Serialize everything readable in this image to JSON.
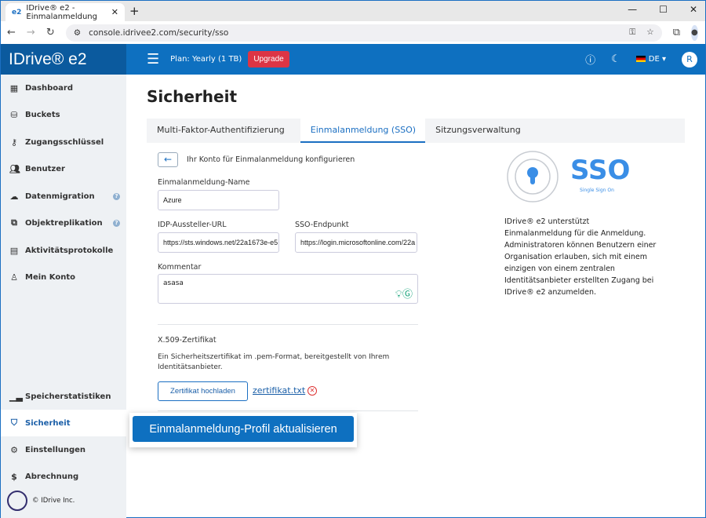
{
  "browser": {
    "tab_title": "IDrive® e2 - Einmalanmeldung",
    "favicon": "e2",
    "url": "console.idrivee2.com/security/sso"
  },
  "header": {
    "logo": "IDrive® e2",
    "plan": "Plan: Yearly (1 TB)",
    "upgrade": "Upgrade",
    "lang": "DE",
    "user_initial": "R"
  },
  "sidebar": {
    "items": [
      {
        "label": "Dashboard",
        "icon": "dashboard-icon"
      },
      {
        "label": "Buckets",
        "icon": "bucket-icon"
      },
      {
        "label": "Zugangsschlüssel",
        "icon": "key-icon"
      },
      {
        "label": "Benutzer",
        "icon": "users-icon"
      },
      {
        "label": "Datenmigration",
        "icon": "cloud-icon"
      },
      {
        "label": "Objektreplikation",
        "icon": "replication-icon"
      },
      {
        "label": "Aktivitätsprotokolle",
        "icon": "log-icon"
      },
      {
        "label": "Mein Konto",
        "icon": "user-icon"
      },
      {
        "label": "Speicherstatistiken",
        "icon": "chart-icon"
      },
      {
        "label": "Sicherheit",
        "icon": "shield-icon"
      },
      {
        "label": "Einstellungen",
        "icon": "gear-icon"
      },
      {
        "label": "Abrechnung",
        "icon": "dollar-icon"
      }
    ],
    "copyright": "© IDrive Inc."
  },
  "page": {
    "title": "Sicherheit",
    "tabs": [
      "Multi-Faktor-Authentifizierung",
      "Einmalanmeldung (SSO)",
      "Sitzungsverwaltung"
    ],
    "back_text": "Ihr Konto für Einmalanmeldung konfigurieren",
    "name_label": "Einmalanmeldung-Name",
    "name_value": "Azure",
    "idp_label": "IDP-Aussteller-URL",
    "idp_value": "https://sts.windows.net/22a1673e-e5",
    "sso_label": "SSO-Endpunkt",
    "sso_value": "https://login.microsoftonline.com/22a",
    "comment_label": "Kommentar",
    "comment_value": "asasa",
    "cert_title": "X.509-Zertifikat",
    "cert_desc": "Ein Sicherheitszertifikat im .pem-Format, bereitgestellt von Ihrem Identitätsanbieter.",
    "upload": "Zertifikat hochladen",
    "file": "zertifikat.txt",
    "submit": "Einmalanmeldung-Profil aktualisieren",
    "sso_logo": "SSO",
    "sso_sub": "Single Sign On",
    "info": "IDrive® e2 unterstützt Einmalanmeldung für die Anmeldung. Administratoren können Benutzern einer Organisation erlauben, sich mit einem einzigen von einem zentralen Identitätsanbieter erstellten Zugang bei IDrive® e2 anzumelden."
  }
}
